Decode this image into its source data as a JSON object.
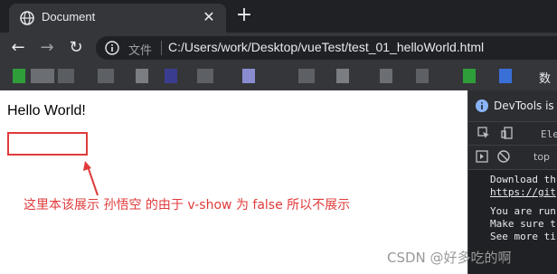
{
  "browser": {
    "tab": {
      "title": "Document",
      "close_glyph": "✕"
    },
    "new_tab_glyph": "+",
    "nav": {
      "back_glyph": "←",
      "forward_glyph": "→",
      "reload_glyph": "↻"
    },
    "address_bar": {
      "site_label": "文件",
      "url": "C:/Users/work/Desktop/vueTest/test_01_helloWorld.html"
    },
    "bookmarks": {
      "last_visible_label": "数"
    },
    "colors": {
      "chrome_dark": "#202124",
      "chrome_mid": "#35363a"
    }
  },
  "page": {
    "hello_text": "Hello World!",
    "annotation_note": "这里本该展示 孙悟空 的由于 v-show 为 false 所以不展示",
    "annotation_color": "#e03a3a",
    "watermark": "CSDN @好多吃的啊"
  },
  "devtools": {
    "banner": "DevTools is n",
    "panel_tab": "Ele",
    "context_selector": "top",
    "console_lines": [
      {
        "text": "Download th",
        "style": "normal"
      },
      {
        "text": "https://git",
        "style": "link"
      },
      {
        "text": "",
        "style": "normal"
      },
      {
        "text": "You are run",
        "style": "normal"
      },
      {
        "text": "Make sure t",
        "style": "normal"
      },
      {
        "text": "See more ti",
        "style": "normal"
      }
    ]
  }
}
